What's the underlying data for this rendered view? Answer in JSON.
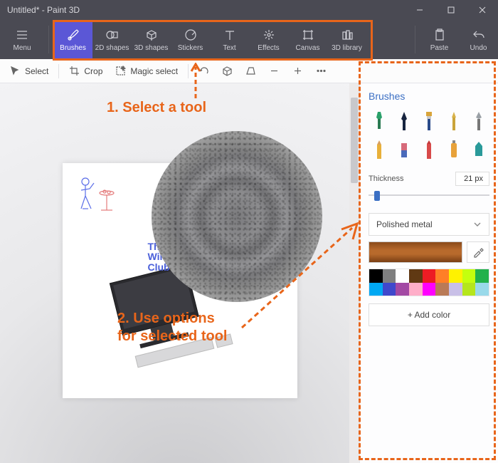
{
  "titlebar": {
    "title": "Untitled* - Paint 3D"
  },
  "toolbar": {
    "menu": "Menu",
    "items": [
      {
        "label": "Brushes",
        "key": "brushes",
        "active": true
      },
      {
        "label": "2D shapes",
        "key": "2d-shapes",
        "active": false
      },
      {
        "label": "3D shapes",
        "key": "3d-shapes",
        "active": false
      },
      {
        "label": "Stickers",
        "key": "stickers",
        "active": false
      },
      {
        "label": "Text",
        "key": "text",
        "active": false
      },
      {
        "label": "Effects",
        "key": "effects",
        "active": false
      },
      {
        "label": "Canvas",
        "key": "canvas",
        "active": false
      },
      {
        "label": "3D library",
        "key": "3d-library",
        "active": false
      }
    ],
    "paste": "Paste",
    "undo": "Undo"
  },
  "secbar": {
    "select": "Select",
    "crop": "Crop",
    "magic_select": "Magic select"
  },
  "sidepanel": {
    "title": "Brushes",
    "brush_names": [
      "marker",
      "calligraphy-pen",
      "oil-brush",
      "watercolor",
      "pixel-pen",
      "pencil",
      "eraser",
      "crayon",
      "spray-can",
      "fill"
    ],
    "thickness_label": "Thickness",
    "thickness_value": "21 px",
    "material_label": "Polished metal",
    "add_color": "+  Add color",
    "palette": [
      "#000000",
      "#7f7f7f",
      "#ffffff",
      "#603913",
      "#ed1c24",
      "#ff7f27",
      "#fff200",
      "#c4ff0e",
      "#22b14c",
      "#00a8f3",
      "#3f48cc",
      "#a349a4",
      "#ffaec9",
      "#ff00ff",
      "#b97a57",
      "#c8bfe7",
      "#b5e61d",
      "#99d9ea"
    ],
    "current_color": "#a0571e"
  },
  "canvas": {
    "watermark": "The\nWindows\nClub"
  },
  "annotations": {
    "step1": "1. Select a tool",
    "step2": "2. Use options\nfor selected tool"
  }
}
